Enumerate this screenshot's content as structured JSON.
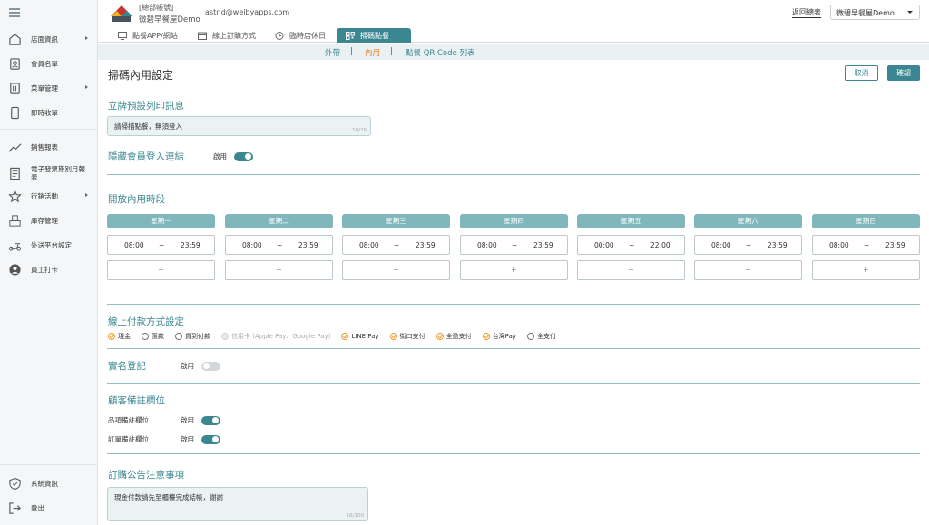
{
  "header": {
    "account_tag": "[總部帳號]",
    "account_name": "微碧早餐屋Demo",
    "email": "astrid@weibyapps.com",
    "back_link": "返回總表",
    "store_select": "微碧早餐屋Demo"
  },
  "sidebar": {
    "items": [
      {
        "label": "店面資訊",
        "icon": "store-icon"
      },
      {
        "label": "會員名單",
        "icon": "member-card-icon"
      },
      {
        "label": "菜單管理",
        "icon": "menu-book-icon"
      },
      {
        "label": "即時收單",
        "icon": "tablet-icon"
      },
      {
        "label": "銷售報表",
        "icon": "trend-chart-icon"
      },
      {
        "label": "電子發票期別月報表",
        "icon": "invoice-icon"
      },
      {
        "label": "行銷活動",
        "icon": "star-gear-icon"
      },
      {
        "label": "庫存管理",
        "icon": "boxes-icon"
      },
      {
        "label": "外送平台設定",
        "icon": "scooter-icon"
      },
      {
        "label": "員工打卡",
        "icon": "staff-icon"
      },
      {
        "label": "系統資訊",
        "icon": "shield-icon"
      },
      {
        "label": "登出",
        "icon": "logout-icon"
      }
    ]
  },
  "tabs": [
    {
      "label": "點餐APP/網站",
      "icon": "monitor-icon"
    },
    {
      "label": "線上訂購方式",
      "icon": "calendar-icon"
    },
    {
      "label": "臨時店休日",
      "icon": "clock-icon"
    },
    {
      "label": "掃碼點餐",
      "icon": "qr-icon"
    }
  ],
  "subtabs": [
    "外帶",
    "內用",
    "點餐 QR Code 列表"
  ],
  "page": {
    "title": "掃碼內用設定",
    "cancel": "取消",
    "confirm": "確認"
  },
  "print_section": {
    "title": "立牌預設列印訊息",
    "value": "請掃描點餐，無須登入",
    "counter": "10/26"
  },
  "hide_login": {
    "title": "隱藏會員登入連結",
    "toggle_label": "啟用",
    "enabled": true
  },
  "hours": {
    "title": "開放內用時段",
    "separator": "~",
    "add": "+",
    "days": [
      {
        "name": "星期一",
        "start": "08:00",
        "end": "23:59"
      },
      {
        "name": "星期二",
        "start": "08:00",
        "end": "23:59"
      },
      {
        "name": "星期三",
        "start": "08:00",
        "end": "23:59"
      },
      {
        "name": "星期四",
        "start": "08:00",
        "end": "23:59"
      },
      {
        "name": "星期五",
        "start": "00:00",
        "end": "22:00"
      },
      {
        "name": "星期六",
        "start": "08:00",
        "end": "23:59"
      },
      {
        "name": "星期日",
        "start": "08:00",
        "end": "23:59"
      }
    ]
  },
  "payment": {
    "title": "線上付款方式設定",
    "options": [
      {
        "label": "現金",
        "checked": true,
        "disabled": false
      },
      {
        "label": "匯款",
        "checked": false,
        "disabled": false
      },
      {
        "label": "貨到付款",
        "checked": false,
        "disabled": false
      },
      {
        "label": "信用卡 (Apple Pay、Google Pay)",
        "checked": false,
        "disabled": true
      },
      {
        "label": "LINE Pay",
        "checked": true,
        "disabled": false
      },
      {
        "label": "街口支付",
        "checked": true,
        "disabled": false
      },
      {
        "label": "全盈支付",
        "checked": true,
        "disabled": false
      },
      {
        "label": "台灣Pay",
        "checked": true,
        "disabled": false
      },
      {
        "label": "全支付",
        "checked": false,
        "disabled": false
      }
    ]
  },
  "real_name": {
    "title": "實名登記",
    "toggle_label": "啟用",
    "enabled": false
  },
  "remarks": {
    "title": "顧客備註欄位",
    "item_label": "品項備註欄位",
    "item_toggle": "啟用",
    "order_label": "訂單備註欄位",
    "order_toggle": "啟用"
  },
  "notice": {
    "title": "訂購公告注意事項",
    "value": "現金付款請先至櫃檯完成結帳，謝謝",
    "counter": "16/100"
  },
  "colors": {
    "accent": "#3b8791",
    "day_header": "#7fb7bd",
    "highlight": "#ee7d22"
  }
}
